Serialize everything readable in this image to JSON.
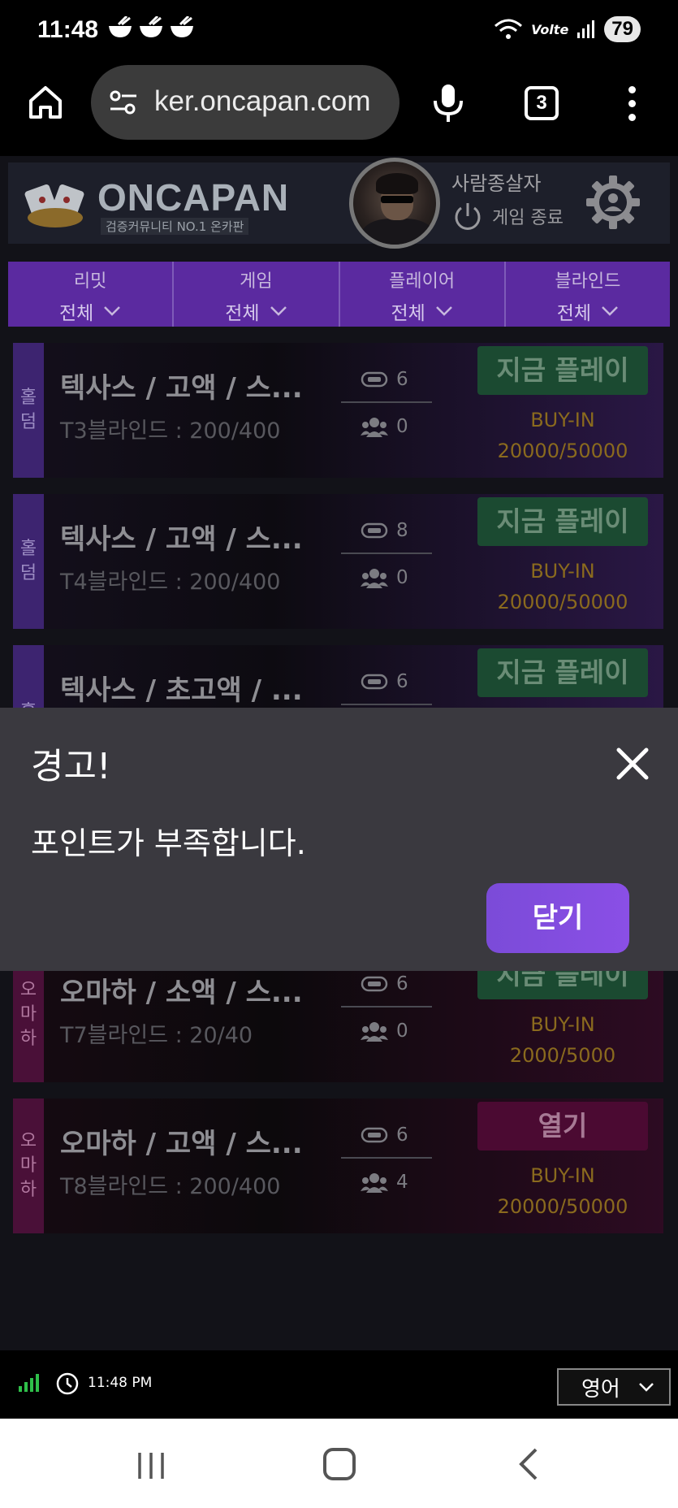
{
  "status_bar": {
    "time": "11:48",
    "battery": "79",
    "network": "Volte"
  },
  "browser": {
    "url": "ker.oncapan.com",
    "tab_count": "3"
  },
  "site_header": {
    "logo_text": "ONCAPAN",
    "logo_tagline": "검증커뮤니티 NO.1 온카판",
    "username": "사람종살자",
    "logout_label": "게임 종료"
  },
  "filters": [
    {
      "label": "리밋",
      "value": "전체"
    },
    {
      "label": "게임",
      "value": "전체"
    },
    {
      "label": "플레이어",
      "value": "전체"
    },
    {
      "label": "블라인드",
      "value": "전체"
    }
  ],
  "rooms": [
    {
      "type": "홀덤",
      "title": "텍사스 / 고액 / 스...",
      "blinds": "T3블라인드 : 200/400",
      "seats": "6",
      "players": "0",
      "action": "지금 플레이",
      "buyin_label": "BUY-IN",
      "buyin": "20000/50000"
    },
    {
      "type": "홀덤",
      "title": "텍사스 / 고액 / 스...",
      "blinds": "T4블라인드 : 200/400",
      "seats": "8",
      "players": "0",
      "action": "지금 플레이",
      "buyin_label": "BUY-IN",
      "buyin": "20000/50000"
    },
    {
      "type": "홀",
      "title": "텍사스 / 초고액 / ...",
      "blinds": "",
      "seats": "6",
      "players": "",
      "action": "지금 플레이",
      "buyin_label": "",
      "buyin": ""
    },
    {
      "type": "오마하",
      "title": "오마하 / 소액 / 스...",
      "blinds": "T7블라인드 : 20/40",
      "seats": "6",
      "players": "0",
      "action": "지금 플레이",
      "buyin_label": "BUY-IN",
      "buyin": "2000/5000"
    },
    {
      "type": "오마하",
      "title": "오마하 / 고액 / 스...",
      "blinds": "T8블라인드 : 200/400",
      "seats": "6",
      "players": "4",
      "action": "열기",
      "buyin_label": "BUY-IN",
      "buyin": "20000/50000"
    }
  ],
  "dialog": {
    "title": "경고!",
    "message": "포인트가 부족합니다.",
    "button": "닫기"
  },
  "footer": {
    "time": "11:48 PM",
    "language": "영어"
  }
}
